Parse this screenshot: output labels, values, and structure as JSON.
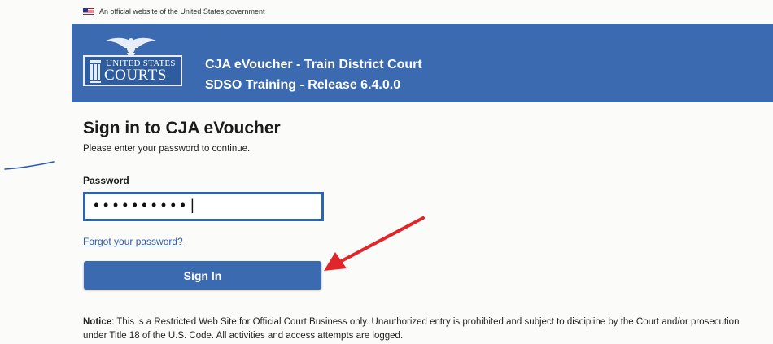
{
  "gov_banner": {
    "text": "An official website of the United States government"
  },
  "logo": {
    "top": "UNITED STATES",
    "bottom": "COURTS"
  },
  "header": {
    "title": "CJA eVoucher - Train District Court",
    "subtitle": "SDSO Training - Release 6.4.0.0"
  },
  "page": {
    "title": "Sign in to CJA eVoucher",
    "subtitle": "Please enter your password to continue."
  },
  "form": {
    "password_label": "Password",
    "password_value": "••••••••••|",
    "forgot_link": "Forgot your password?",
    "signin_button": "Sign In"
  },
  "notice": {
    "label": "Notice",
    "text": ": This is a Restricted Web Site for Official Court Business only. Unauthorized entry is prohibited and subject to discipline by the Court and/or prosecution under Title 18 of the U.S. Code. All activities and access attempts are logged."
  },
  "colors": {
    "header_blue": "#3b6ab1",
    "annotation_red": "#e0262a",
    "link_blue": "#2a5bb0"
  }
}
